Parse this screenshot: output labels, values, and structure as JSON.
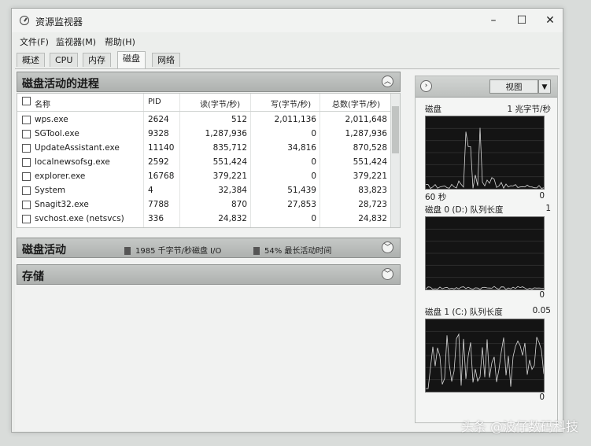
{
  "window": {
    "title": "资源监视器"
  },
  "menu": [
    "文件(F)",
    "监视器(M)",
    "帮助(H)"
  ],
  "tabs": [
    {
      "label": "概述",
      "active": false
    },
    {
      "label": "CPU",
      "active": false
    },
    {
      "label": "内存",
      "active": false
    },
    {
      "label": "磁盘",
      "active": true
    },
    {
      "label": "网络",
      "active": false
    }
  ],
  "processes": {
    "title": "磁盘活动的进程",
    "columns": [
      "名称",
      "PID",
      "读(字节/秒)",
      "写(字节/秒)",
      "总数(字节/秒)"
    ],
    "rows": [
      {
        "name": "wps.exe",
        "pid": "2624",
        "read": "512",
        "write": "2,011,136",
        "total": "2,011,648"
      },
      {
        "name": "SGTool.exe",
        "pid": "9328",
        "read": "1,287,936",
        "write": "0",
        "total": "1,287,936"
      },
      {
        "name": "UpdateAssistant.exe",
        "pid": "11140",
        "read": "835,712",
        "write": "34,816",
        "total": "870,528"
      },
      {
        "name": "localnewsofsg.exe",
        "pid": "2592",
        "read": "551,424",
        "write": "0",
        "total": "551,424"
      },
      {
        "name": "explorer.exe",
        "pid": "16768",
        "read": "379,221",
        "write": "0",
        "total": "379,221"
      },
      {
        "name": "System",
        "pid": "4",
        "read": "32,384",
        "write": "51,439",
        "total": "83,823"
      },
      {
        "name": "Snagit32.exe",
        "pid": "7788",
        "read": "870",
        "write": "27,853",
        "total": "28,723"
      },
      {
        "name": "svchost.exe (netsvcs)",
        "pid": "336",
        "read": "24,832",
        "write": "0",
        "total": "24,832"
      }
    ]
  },
  "disk_activity": {
    "title": "磁盘活动",
    "io_label": "1985 千字节/秒磁盘 I/O",
    "active_time_label": "54% 最长活动时间"
  },
  "storage": {
    "title": "存储"
  },
  "right_panel": {
    "view_label": "视图",
    "graphs": [
      {
        "title": "磁盘",
        "scale": "1 兆字节/秒",
        "foot_left": "60 秒",
        "foot_right": "0"
      },
      {
        "title": "磁盘 0 (D:) 队列长度",
        "scale": "1",
        "foot_left": "",
        "foot_right": "0"
      },
      {
        "title": "磁盘 1 (C:) 队列长度",
        "scale": "0.05",
        "foot_left": "",
        "foot_right": "0"
      }
    ]
  },
  "watermark": "头条 @波仔数码科技",
  "colors": {
    "graph_bg": "#141414",
    "graph_line": "#d8d8d8",
    "header_grad": "#b3b6b4"
  }
}
